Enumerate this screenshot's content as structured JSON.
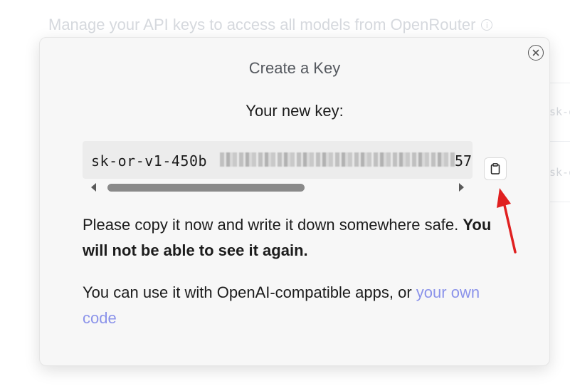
{
  "background": {
    "header_text": "Manage your API keys to access all models from OpenRouter",
    "info_icon": "info-icon",
    "row_1_text": "sk-o",
    "row_2_text": "sk-o"
  },
  "modal": {
    "title": "Create a Key",
    "key_heading": "Your new key:",
    "key_prefix": "sk-or-v1-450b",
    "key_suffix": "57",
    "copy_icon": "clipboard-icon",
    "close_icon": "close-icon",
    "warning_plain": "Please copy it now and write it down somewhere safe. ",
    "warning_strong": "You will not be able to see it again.",
    "usage_plain": "You can use it with OpenAI-compatible apps, or ",
    "usage_link": "your own code"
  },
  "colors": {
    "link": "#8b93ea",
    "annotation_arrow": "#e02020"
  }
}
